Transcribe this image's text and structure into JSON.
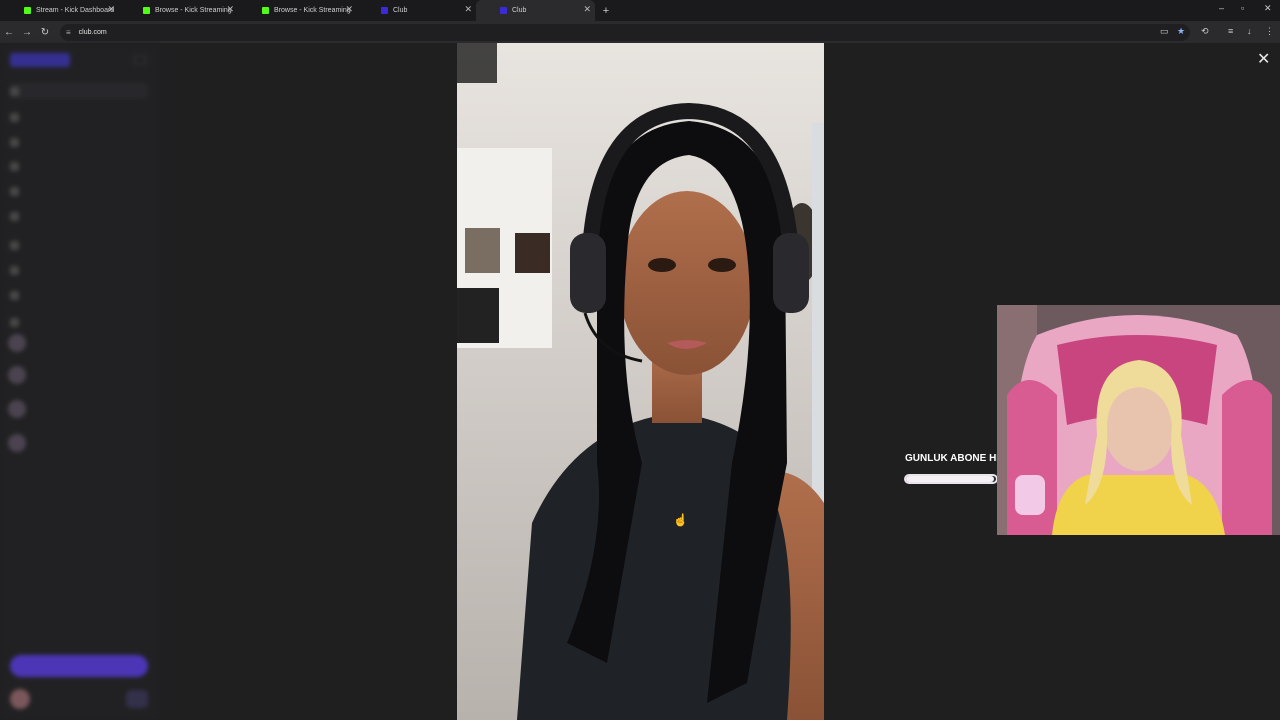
{
  "tabs": [
    {
      "title": "Stream - Kick Dashboard",
      "favicon_color": "#53fc18",
      "active": false
    },
    {
      "title": "Browse - Kick Streaming",
      "favicon_color": "#53fc18",
      "active": false
    },
    {
      "title": "Browse - Kick Streaming",
      "favicon_color": "#53fc18",
      "active": false
    },
    {
      "title": "Club",
      "favicon_color": "#3b2bd6",
      "active": false
    },
    {
      "title": "Club",
      "favicon_color": "#3b2bd6",
      "active": true
    }
  ],
  "new_tab_icon": "plus-icon",
  "address_bar": {
    "url": "club.com"
  },
  "overlay": {
    "title": "GÜNLÜK ABONE HE",
    "progress": 0.98
  },
  "colors": {
    "accent": "#5b3ee8",
    "kick_green": "#53fc18",
    "page_bg": "#1f1f20"
  }
}
